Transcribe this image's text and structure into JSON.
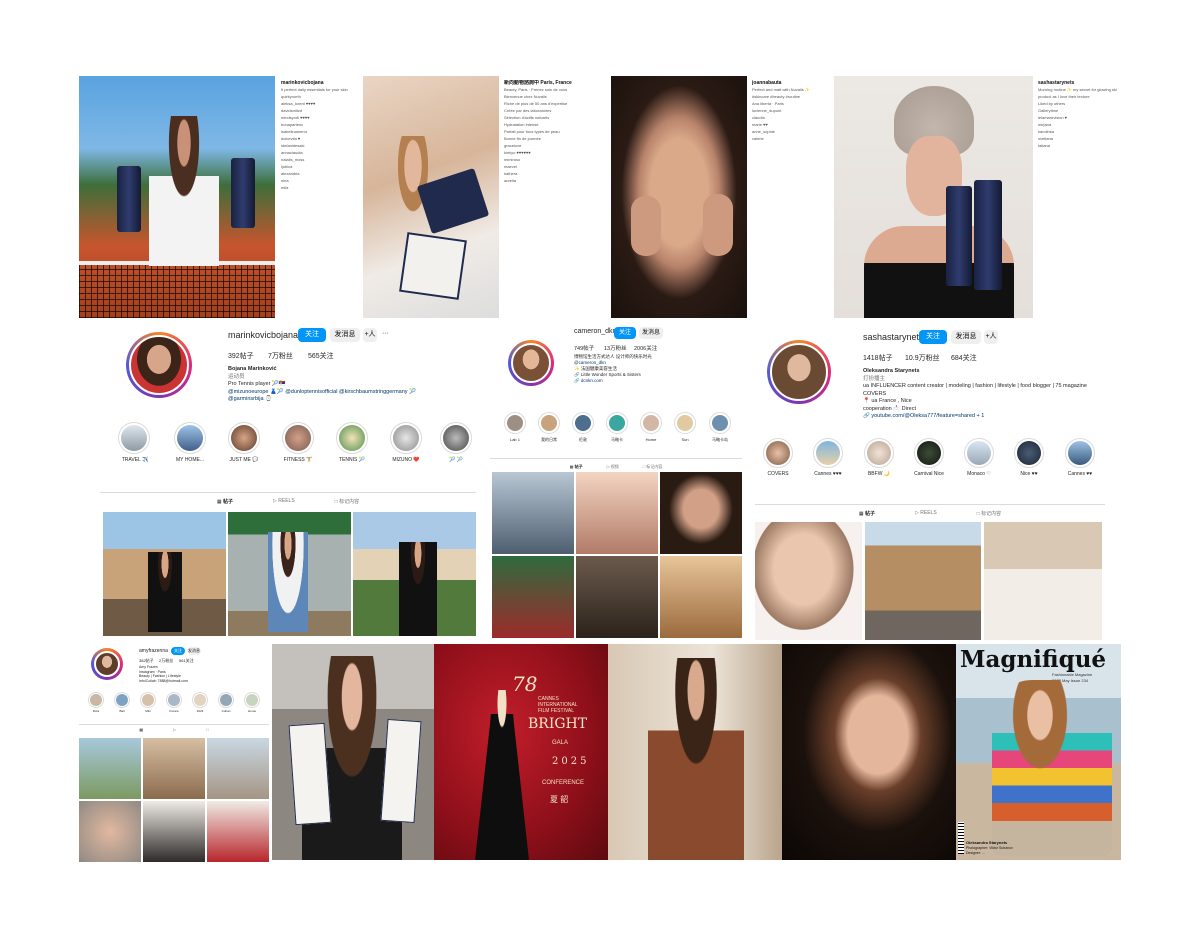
{
  "colors": {
    "accent": "#0095f6",
    "link": "#00376b"
  },
  "post1": {
    "username": "marinkovicbojana",
    "comments": [
      "marinkovicbojana",
      "It perfect daily essentials for your skin",
      "quirkynorth",
      "aleksa_lorent ♥♥♥♥",
      "davidsmitzd",
      "mindsyndi ♥♥♥♥",
      "bonapartesx",
      "isabelinamerro",
      "dolcevita ♥",
      "stefanidesaki",
      "annaclaudia",
      "natalis_moss",
      "ljubica",
      "alexandria",
      "nina",
      "mila"
    ]
  },
  "post2": {
    "username": "新向動物諮詢中",
    "comments": [
      "新向動物諮詢中 Paris, France",
      "Beauty, Paris · Prenez soin de vous",
      "Bienvenue chez Nuvalis",
      "Riche de plus de 50 ans d'expertise",
      "Créée par des laboratoires",
      "Sélection d'actifs naturels",
      "Hydratation intense",
      "Parfait pour tous types de peau",
      "Bonne fin de journée",
      "gracelove",
      "kimiyo ♥♥♥♥♥♥",
      "mimiroso",
      "maevel",
      "kathera",
      "aurelia"
    ]
  },
  "post3": {
    "username": "joannabauta",
    "comments": [
      "joannabauta",
      "Perfect and matt with Nuvalis ✨",
      "#skincare #beauty #routine",
      "Ana liberta · Paris",
      "lucienne_dupont",
      "claudia",
      "marie ♥♥",
      "anne_sophie",
      "valerie"
    ]
  },
  "post4": {
    "username": "sashastarynets",
    "comments": [
      "sashastarynets",
      "Morning routine ✨ my secret for glowing skin",
      "product as I love their texture",
      "Liked by others",
      "Gallerytime",
      "lelamarevision ♥",
      "mirjana",
      "karolinka",
      "svetlana",
      "tatiana"
    ]
  },
  "profile1": {
    "username": "marinkovicbojana",
    "follow": "关注",
    "message": "发消息",
    "add": "+​人",
    "more": "···",
    "posts": "392帖子",
    "followers": "7万粉丝",
    "following": "565关注",
    "name": "Bojana Marinković",
    "category": "运动员",
    "bio1": "Pro Tennis player 🎾🇷🇸",
    "bio2": "@mizunoeurope 👗🎾 @dunloptennisofficial @kirschbaumstringgermany 🎾",
    "bio3": "@garminsrbija ⌚",
    "highlights": [
      "TRAVEL ✈️",
      "MY HOME...",
      "JUST ME 💬",
      "FITNESS 🏋️",
      "TENNIS 🎾",
      "MIZUNO ❤️",
      "🎾 🎾"
    ],
    "tabs": [
      "▦ 帖子",
      "▷ REELS",
      "□ 标记内容"
    ]
  },
  "profile2": {
    "username": "cameron_dkn",
    "follow": "关注",
    "message": "发消息",
    "posts": "749帖子",
    "followers": "13万粉丝",
    "following": "2006关注",
    "bio1": "博物馆生活方式达人 设计师的快乐时光",
    "bio2": "@cameron_dkn",
    "bio3": "✨ 法国健康美容生活",
    "bio4": "🔗 Little Wonder Sports & Sisters",
    "bio5": "🔗 dcnkn.com",
    "highlights": [
      "Lab 1",
      "我的日常",
      "伦敦",
      "马略卡",
      "Home",
      "Sun",
      "马略卡岛"
    ],
    "tabs": [
      "▦ 帖子",
      "▷ 视频",
      "□ 标记内容"
    ]
  },
  "profile3": {
    "username": "sashastarynets",
    "follow": "关注",
    "message": "发消息",
    "add": "+​人",
    "posts": "1418帖子",
    "followers": "10.9万粉丝",
    "following": "684关注",
    "name": "Oleksandra Starynets",
    "category": "打扮播主",
    "bio1": "ua INFLUENCER content creator | modeling | fashion | lifestyle | food blogger | 75 magazine",
    "bio2": "COVERS",
    "bio3": "📍 ua France , Nice",
    "bio4": "cooperation 📩 Direct",
    "bio5": "🔗 youtube.com/@Oleksa777/feature=shared + 1",
    "highlights": [
      "COVERS",
      "Cannes ♥♥♥",
      "BBFW 🌙",
      "Carnival Nice",
      "Monaco ♡",
      "Nice ♥♥",
      "Cannes ♥♥"
    ],
    "tabs": [
      "▦ 帖子",
      "▷ REELS",
      "□ 标记内容"
    ]
  },
  "profile4": {
    "username": "amyfrazenna",
    "follow": "关注",
    "message": "发消息",
    "posts": "382帖子",
    "followers": "2万粉丝",
    "following": "561关注",
    "bio1": "Amy Frazen",
    "bio2": "Instagram · Paris",
    "bio3": "Beauty | Fashion | Lifestyle",
    "bio4": "Info/Collab: 7888@hotmail.com",
    "highlights": [
      "Ibiza",
      "Bali",
      "Milo",
      "France",
      "2023",
      "Cuban",
      "Home"
    ],
    "tabs": [
      "▦",
      "▷",
      "□"
    ]
  },
  "festival": {
    "num": "78",
    "line1": "CANNES",
    "line2": "INTERNATIONAL",
    "line3": "FILM FESTIVAL",
    "line4": "BRIGHT",
    "line5": "GALA",
    "year": "2025",
    "line6": "CONFERENCE",
    "sign": "夏 韶"
  },
  "magazine": {
    "title": "Magnifiqué",
    "subtitle": "Fashionable Magazine",
    "issue": "2025 May Issue 234",
    "credits1": "Oleksandra Starynets",
    "credits2": "Photographer: Viktor Suhanov",
    "credits3": "Designer: ..."
  }
}
